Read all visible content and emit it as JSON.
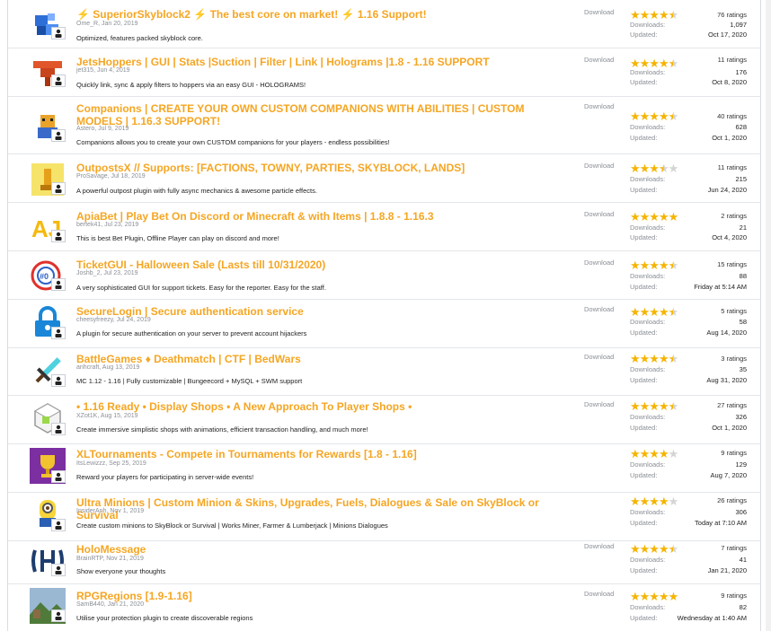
{
  "labels": {
    "download": "Download",
    "downloads": "Downloads:",
    "updated": "Updated:"
  },
  "resources": [
    {
      "title": "⚡ SuperiorSkyblock2 ⚡ The best core on market! ⚡ 1.16 Support!",
      "author": "Ome_R, Jan 20, 2019",
      "tagline": "Optimized, features packed skyblock core.",
      "ratings": "76 ratings",
      "downloads": "1,097",
      "updated": "Oct 17, 2020",
      "stars": 4.5,
      "icon": "skyblock-icon"
    },
    {
      "title": "JetsHoppers | GUI | Stats |Suction | Filter | Link | Holograms |1.8 - 1.16 SUPPORT",
      "author": "jet315, Jun 4, 2019",
      "tagline": "Quickly link, sync & apply filters to hoppers via an easy GUI - HOLOGRAMS!",
      "ratings": "11 ratings",
      "downloads": "176",
      "updated": "Oct 8, 2020",
      "stars": 4.5,
      "icon": "hopper-icon"
    },
    {
      "title": "Companions | CREATE YOUR OWN CUSTOM COMPANIONS WITH ABILITIES | CUSTOM MODELS | 1.16.3 SUPPORT!",
      "author": "Astero, Jul 9, 2019",
      "tagline": "Companions allows you to create your own CUSTOM companions for your players - endless possibilities!",
      "ratings": "40 ratings",
      "downloads": "628",
      "updated": "Oct 1, 2020",
      "stars": 4.5,
      "icon": "companion-icon"
    },
    {
      "title": "OutpostsX // Supports: [FACTIONS, TOWNY, PARTIES, SKYBLOCK, LANDS]",
      "author": "ProSavage, Jul 18, 2019",
      "tagline": "A powerful outpost plugin with fully async mechanics & awesome particle effects.",
      "ratings": "11 ratings",
      "downloads": "215",
      "updated": "Jun 24, 2020",
      "stars": 3.5,
      "icon": "outpost-icon"
    },
    {
      "title": "ApiaBet | Play Bet On Discord or Minecraft & with Items | 1.8.8 - 1.16.3",
      "author": "bertek41, Jul 23, 2019",
      "tagline": "This is best Bet Plugin, Offline Player can play on discord and more!",
      "ratings": "2 ratings",
      "downloads": "21",
      "updated": "Oct 4, 2020",
      "stars": 5,
      "icon": "apiabet-icon"
    },
    {
      "title": "TicketGUI - Halloween Sale (Lasts till 10/31/2020)",
      "author": "Joshb_2, Jul 23, 2019",
      "tagline": "A very sophisticated GUI for support tickets. Easy for the reporter. Easy for the staff.",
      "ratings": "15 ratings",
      "downloads": "88",
      "updated": "Friday at 5:14 AM",
      "stars": 4.5,
      "icon": "ticket-icon"
    },
    {
      "title": "SecureLogin | Secure authentication service",
      "author": "cheesyfreezy, Jul 24, 2019",
      "tagline": "A plugin for secure authentication on your server to prevent account hijackers",
      "ratings": "5 ratings",
      "downloads": "58",
      "updated": "Aug 14, 2020",
      "stars": 4.5,
      "icon": "lock-icon"
    },
    {
      "title": "BattleGames ♦ Deathmatch | CTF | BedWars",
      "author": "anhcraft, Aug 13, 2019",
      "tagline": "MC 1.12 - 1.16 | Fully customizable | Bungeecord + MySQL + SWM support",
      "ratings": "3 ratings",
      "downloads": "35",
      "updated": "Aug 31, 2020",
      "stars": 4.5,
      "icon": "sword-icon"
    },
    {
      "title": "• 1.16 Ready • Display Shops • A New Approach To Player Shops •",
      "author": "XZot1K, Aug 15, 2019",
      "tagline": "Create immersive simplistic shops with animations, efficient transaction handling, and much more!",
      "ratings": "27 ratings",
      "downloads": "326",
      "updated": "Oct 1, 2020",
      "stars": 4.5,
      "icon": "shop-icon"
    },
    {
      "title": "XLTournaments - Compete in Tournaments for Rewards [1.8 - 1.16]",
      "author": "ItsLewizzz, Sep 25, 2019",
      "tagline": "Reward your players for participating in server-wide events!",
      "ratings": "9 ratings",
      "downloads": "129",
      "updated": "Aug 7, 2020",
      "stars": 4,
      "icon": "trophy-icon"
    },
    {
      "title": "Ultra Minions | Custom Minion & Skins, Upgrades, Fuels, Dialogues & Sale on SkyBlock or Survival",
      "author": "InsiderAnh, Nov 1, 2019",
      "tagline": "Create custom minions to SkyBlock or Survival | Works Miner, Farmer & Lumberjack | Minions Dialogues",
      "ratings": "26 ratings",
      "downloads": "306",
      "updated": "Today at 7:10 AM",
      "stars": 4,
      "icon": "minion-icon"
    },
    {
      "title": "HoloMessage",
      "author": "BrainRTP, Nov 21, 2019",
      "tagline": "Show everyone your thoughts",
      "ratings": "7 ratings",
      "downloads": "41",
      "updated": "Jan 21, 2020",
      "stars": 4.5,
      "icon": "holo-icon"
    },
    {
      "title": "RPGRegions [1.9-1.16]",
      "author": "SamB440, Jan 21, 2020",
      "tagline": "Utilise your protection plugin to create discoverable regions",
      "ratings": "9 ratings",
      "downloads": "82",
      "updated": "Wednesday at 1:40 AM",
      "stars": 5,
      "icon": "landscape-icon"
    }
  ]
}
